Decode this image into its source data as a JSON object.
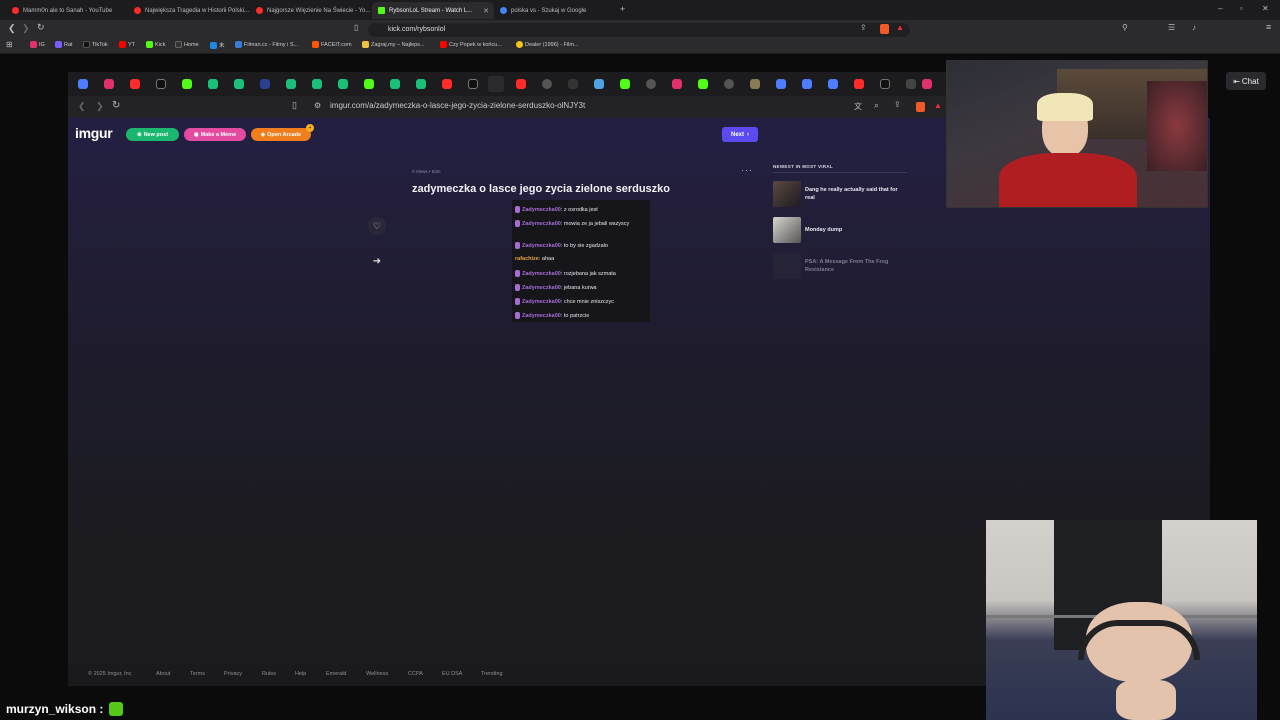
{
  "outer_browser": {
    "tabs": [
      {
        "title": "Mamm0n ale to Sanah - YouTube",
        "color": "#ff2a2a"
      },
      {
        "title": "Największa Tragedia w Historii Polski...",
        "color": "#ff2a2a"
      },
      {
        "title": "Najgorsze Więzienie Na Świecie - Yo...",
        "color": "#ff2a2a"
      },
      {
        "title": "RybsonLoL Stream - Watch L...",
        "color": "#53fc18",
        "active": true
      },
      {
        "title": "polska vs - Szukaj w Google",
        "color": "#4285f4"
      }
    ],
    "url": "kick.com/rybsonlol",
    "bookmarks": [
      {
        "label": "IG",
        "color": "#e1306c"
      },
      {
        "label": "Rat",
        "color": "#7b5cff"
      },
      {
        "label": "TikTok",
        "color": "#222"
      },
      {
        "label": "YT",
        "color": "#ff0000"
      },
      {
        "label": "Kick",
        "color": "#53fc18"
      },
      {
        "label": "Home",
        "color": "#333"
      },
      {
        "label": "未",
        "color": "#1e88e5"
      },
      {
        "label": "Filman.cc - Filmy i S...",
        "color": "#3a7bd5"
      },
      {
        "label": "FACEIT.com",
        "color": "#ff5500"
      },
      {
        "label": "Zagraj.my – Najleps...",
        "color": "#f0c040"
      },
      {
        "label": "Czy Popek w końcu...",
        "color": "#ff0000"
      },
      {
        "label": "Dealer (1996) - Film...",
        "color": "#f5c518"
      }
    ]
  },
  "inner_browser": {
    "url": "imgur.com/a/zadymeczka-o-lasce-jego-zycia-zielone-serduszko-olNJY3t"
  },
  "imgur": {
    "logo": "imgur",
    "new_post": "New post",
    "make_meme": "Make a Meme",
    "open_arcade": "Open Arcade",
    "next": "Next",
    "meta": "0 Views • 53m",
    "title": "zadymeczka o lasce jego zycia zielone serduszko",
    "chat": [
      {
        "user": "Zadymeczka00",
        "text": ": z osrodka jest"
      },
      {
        "user": "Zadymeczka00",
        "text": ": mowia ze ja jebali wszyscy"
      },
      {
        "user": "Zadymeczka00",
        "text": ": to by sie zgadzalo"
      },
      {
        "user": "rafachize",
        "text": ": ahaa"
      },
      {
        "user": "Zadymeczka00",
        "text": ": rozjebana jak szmata"
      },
      {
        "user": "Zadymeczka00",
        "text": ": jebana kurwa"
      },
      {
        "user": "Zadymeczka00",
        "text": ": chce mnie zniszczyc"
      },
      {
        "user": "Zadymeczka00",
        "text": ": to patrzcie"
      }
    ],
    "viral_heading": "NEWEST IN MOST VIRAL",
    "viral_items": [
      {
        "title": "Dang he really actually said that for real"
      },
      {
        "title": "Monday dump"
      },
      {
        "title": "PSA: A Message From The Frog Resistance"
      }
    ],
    "footer": [
      "© 2025 Imgur, Inc",
      "About",
      "Terms",
      "Privacy",
      "Rules",
      "Help",
      "Emerald",
      "Wellness",
      "CCPA",
      "EU DSA",
      "Trending"
    ]
  },
  "stream": {
    "chat_button": "Chat",
    "alert_user": "murzyn_wikson :"
  }
}
